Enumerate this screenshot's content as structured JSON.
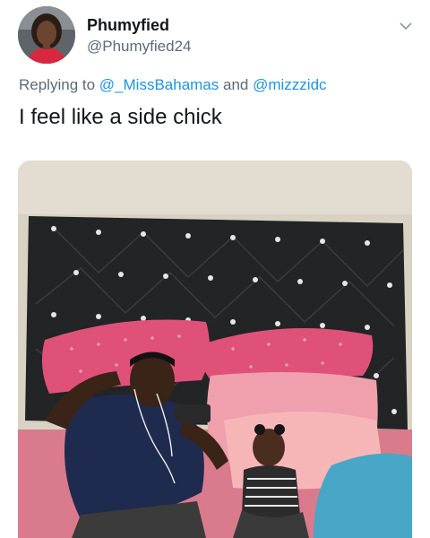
{
  "tweet": {
    "display_name": "Phumyfied",
    "handle": "@Phumyfied24",
    "reply_prefix": "Replying to",
    "reply_mention_1": "@_MissBahamas",
    "reply_joiner": "and",
    "reply_mention_2": "@mizzzidc",
    "text": "I feel like a side chick",
    "avatar_icon": "profile-photo",
    "menu_icon": "chevron-down-icon",
    "media_description_icon": "photo-of-man-and-child-on-bed"
  },
  "colors": {
    "link": "#1b95e0",
    "muted": "#5b6b78",
    "text": "#14171a"
  }
}
